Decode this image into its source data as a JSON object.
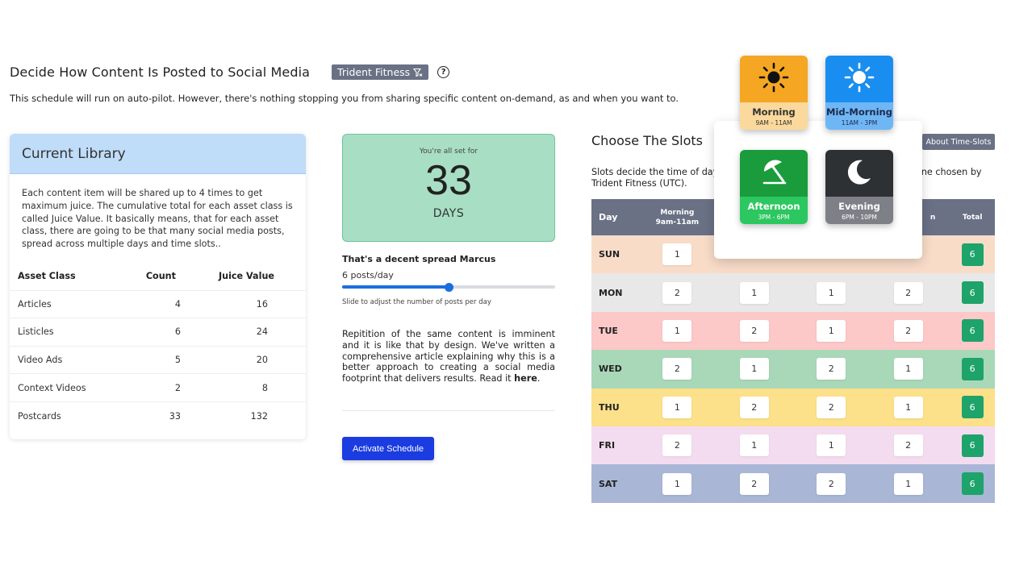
{
  "header": {
    "title": "Decide How Content Is Posted to Social Media",
    "brand": "Trident Fitness",
    "help_icon": "question-circle-icon",
    "subtitle": "This schedule will run on auto-pilot. However, there's nothing stopping you from sharing specific content on-demand, as and when you want to."
  },
  "library": {
    "title": "Current Library",
    "description": "Each content item will be shared up to 4 times to get maximum juice. The cumulative total for each asset class is called Juice Value. It basically means, that for each asset class, there are going to be that many social media posts, spread across multiple days and time slots..",
    "columns": [
      "Asset Class",
      "Count",
      "Juice Value"
    ],
    "rows": [
      {
        "asset": "Articles",
        "count": "4",
        "juice": "16"
      },
      {
        "asset": "Listicles",
        "count": "6",
        "juice": "24"
      },
      {
        "asset": "Video Ads",
        "count": "5",
        "juice": "20"
      },
      {
        "asset": "Context Videos",
        "count": "2",
        "juice": "8"
      },
      {
        "asset": "Postcards",
        "count": "33",
        "juice": "132"
      }
    ]
  },
  "summary": {
    "caption": "You're all set for",
    "days": "33",
    "days_label": "DAYS",
    "spread_title": "That's a decent spread Marcus",
    "posts_label": "6 posts/day",
    "slider_value": 0.5,
    "slider_hint": "Slide to adjust the number of posts per day",
    "repetition_text": "Repitition of the same content is imminent and it is like that by design. We've written a comprehensive article explaining why this is a better approach to creating a social media footprint that delivers results. Read it ",
    "repetition_link": "here",
    "repetition_end": ".",
    "activate_label": "Activate Schedule"
  },
  "slots": {
    "title": "Choose The Slots",
    "about_label": "About Time-Slots",
    "desc_left": "Slots decide the time of day",
    "desc_right": "one chosen by",
    "desc_line2": "Trident Fitness (UTC).",
    "header": {
      "day": "Day",
      "morning": "Morning",
      "morning_time": "9am-11am",
      "col4_suffix": "n",
      "total": "Total"
    },
    "rows": [
      {
        "day": "SUN",
        "bg": "#f8dcc8",
        "v": [
          "1",
          "",
          "",
          ""
        ],
        "total": "6"
      },
      {
        "day": "MON",
        "bg": "#e8e8e8",
        "v": [
          "2",
          "1",
          "1",
          "2"
        ],
        "total": "6"
      },
      {
        "day": "TUE",
        "bg": "#fcc8c8",
        "v": [
          "1",
          "2",
          "1",
          "2"
        ],
        "total": "6"
      },
      {
        "day": "WED",
        "bg": "#a8d8b8",
        "v": [
          "2",
          "1",
          "2",
          "1"
        ],
        "total": "6"
      },
      {
        "day": "THU",
        "bg": "#fde08a",
        "v": [
          "1",
          "2",
          "2",
          "1"
        ],
        "total": "6"
      },
      {
        "day": "FRI",
        "bg": "#f4dcf0",
        "v": [
          "2",
          "1",
          "1",
          "2"
        ],
        "total": "6"
      },
      {
        "day": "SAT",
        "bg": "#a9b6d6",
        "v": [
          "1",
          "2",
          "2",
          "1"
        ],
        "total": "6"
      }
    ]
  },
  "slot_cards": [
    {
      "name": "Morning",
      "time": "9AM - 11AM",
      "icon": "sun-icon",
      "top": "#f5a623",
      "bottom": "#fbd99c",
      "text": "#333333"
    },
    {
      "name": "Mid-Morning",
      "time": "11AM - 3PM",
      "icon": "bright-sun-icon",
      "top": "#1a8ef0",
      "bottom": "#6fb6f5",
      "text": "#1d2a4a"
    },
    {
      "name": "Afternoon",
      "time": "3PM - 6PM",
      "icon": "beach-umbrella-icon",
      "top": "#1a9c3c",
      "bottom": "#2cc760",
      "text": "#ffffff"
    },
    {
      "name": "Evening",
      "time": "6PM - 10PM",
      "icon": "moon-icon",
      "top": "#2e3133",
      "bottom": "#7d8087",
      "text": "#ffffff"
    }
  ]
}
